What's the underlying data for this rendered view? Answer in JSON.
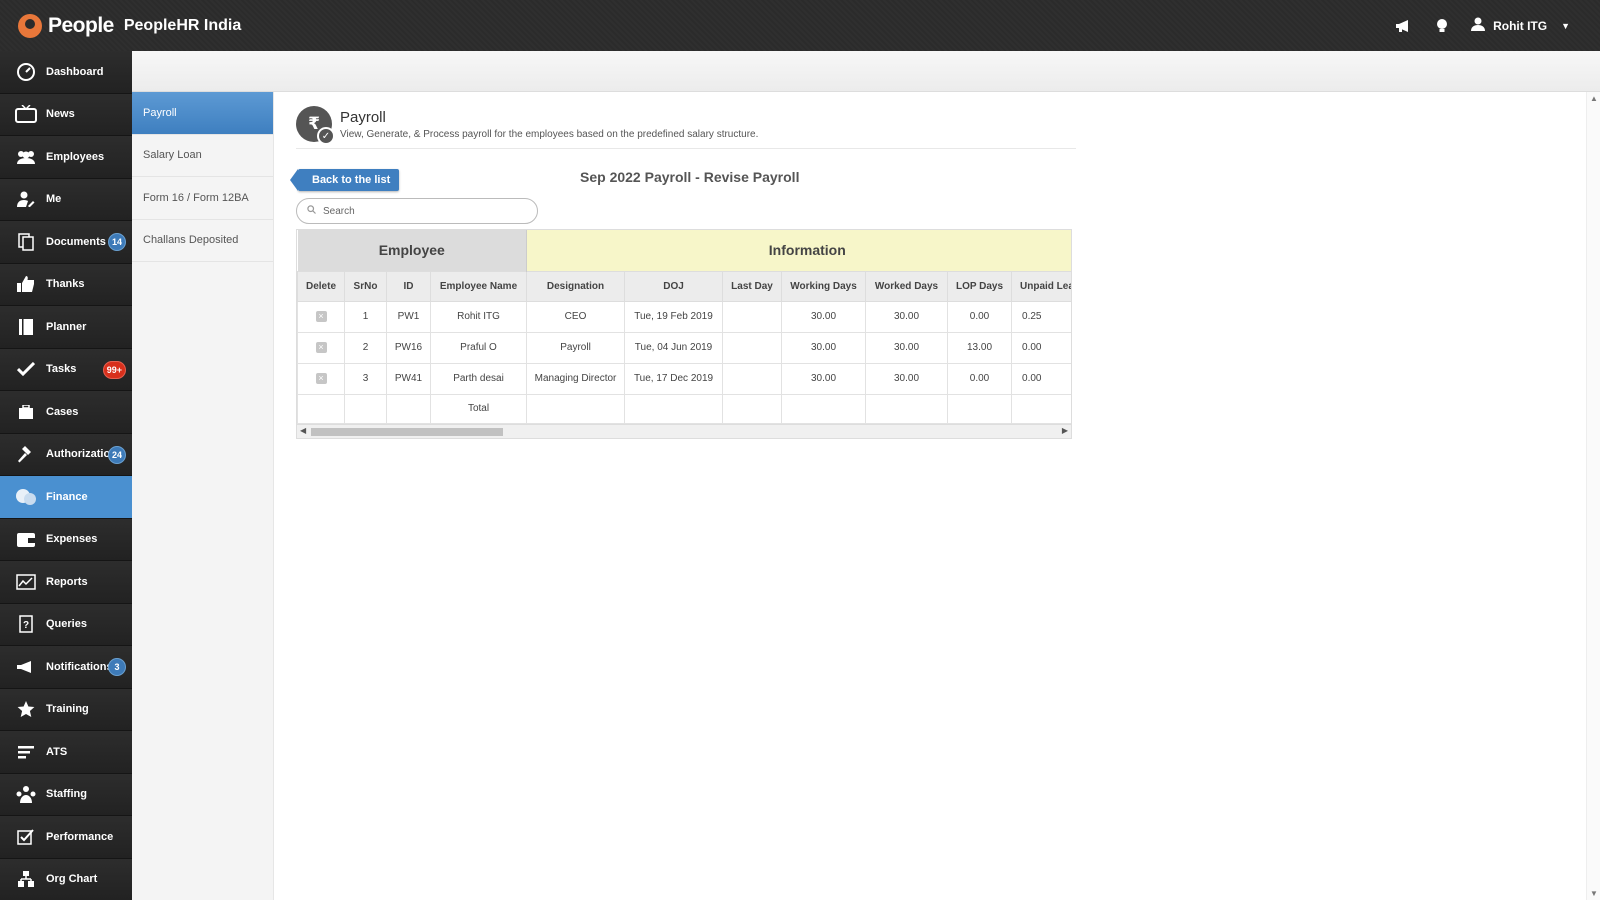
{
  "app": {
    "logo_text": "People",
    "company": "PeopleHR India",
    "user_name": "Rohit ITG"
  },
  "sidebar": {
    "items": [
      {
        "label": "Dashboard",
        "icon": "dashboard-icon",
        "badge": ""
      },
      {
        "label": "News",
        "icon": "tv-icon",
        "badge": ""
      },
      {
        "label": "Employees",
        "icon": "users-icon",
        "badge": ""
      },
      {
        "label": "Me",
        "icon": "user-edit-icon",
        "badge": ""
      },
      {
        "label": "Documents",
        "icon": "documents-icon",
        "badge": "14"
      },
      {
        "label": "Thanks",
        "icon": "thumbs-up-icon",
        "badge": ""
      },
      {
        "label": "Planner",
        "icon": "planner-icon",
        "badge": ""
      },
      {
        "label": "Tasks",
        "icon": "check-icon",
        "badge": "99+"
      },
      {
        "label": "Cases",
        "icon": "briefcase-icon",
        "badge": ""
      },
      {
        "label": "Authorizations",
        "icon": "gavel-icon",
        "badge": "24"
      },
      {
        "label": "Finance",
        "icon": "finance-icon",
        "badge": ""
      },
      {
        "label": "Expenses",
        "icon": "wallet-icon",
        "badge": ""
      },
      {
        "label": "Reports",
        "icon": "chart-icon",
        "badge": ""
      },
      {
        "label": "Queries",
        "icon": "question-icon",
        "badge": ""
      },
      {
        "label": "Notifications",
        "icon": "megaphone-icon",
        "badge": "3"
      },
      {
        "label": "Training",
        "icon": "star-icon",
        "badge": ""
      },
      {
        "label": "ATS",
        "icon": "ats-icon",
        "badge": ""
      },
      {
        "label": "Staffing",
        "icon": "staffing-icon",
        "badge": ""
      },
      {
        "label": "Performance",
        "icon": "checkbox-icon",
        "badge": ""
      },
      {
        "label": "Org Chart",
        "icon": "org-chart-icon",
        "badge": ""
      }
    ]
  },
  "subnav": {
    "items": [
      {
        "label": "Payroll"
      },
      {
        "label": "Salary Loan"
      },
      {
        "label": "Form 16 / Form 12BA"
      },
      {
        "label": "Challans Deposited"
      }
    ]
  },
  "page": {
    "title": "Payroll",
    "subtitle": "View, Generate, & Process payroll for the employees based on the predefined salary structure.",
    "back_label": "Back to the list",
    "payroll_title": "Sep 2022 Payroll - Revise Payroll",
    "search_placeholder": "Search"
  },
  "table": {
    "group_employee": "Employee",
    "group_information": "Information",
    "columns": [
      "Delete",
      "SrNo",
      "ID",
      "Employee Name",
      "Designation",
      "DOJ",
      "Last Day",
      "Working Days",
      "Worked Days",
      "LOP Days",
      "Unpaid Lea"
    ],
    "rows": [
      [
        "1",
        "PW1",
        "Rohit ITG",
        "CEO",
        "Tue, 19 Feb 2019",
        "",
        "30.00",
        "30.00",
        "0.00",
        "0.25"
      ],
      [
        "2",
        "PW16",
        "Praful O",
        "Payroll",
        "Tue, 04 Jun 2019",
        "",
        "30.00",
        "30.00",
        "13.00",
        "0.00"
      ],
      [
        "3",
        "PW41",
        "Parth desai",
        "Managing Director",
        "Tue, 17 Dec 2019",
        "",
        "30.00",
        "30.00",
        "0.00",
        "0.00"
      ]
    ],
    "total_label": "Total"
  },
  "colors": {
    "accent": "#4a90d0",
    "sidebar_bg": "#232323",
    "badge_blue": "#3d7ab8",
    "badge_red": "#d8301c",
    "info_header": "#f7f6c9"
  }
}
